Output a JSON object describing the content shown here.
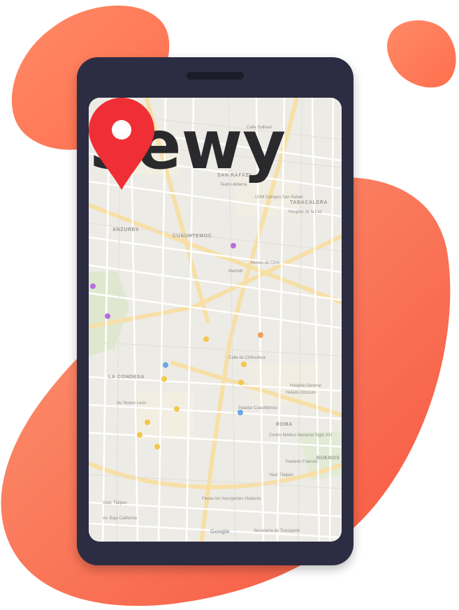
{
  "brand": {
    "logo_text": "Sewy",
    "logo_color": "#2a2a2d"
  },
  "colors": {
    "blob_light": "#fd9974",
    "blob_dark": "#f6553f",
    "phone_body": "#2c2c42",
    "pin": "#ef2f35"
  },
  "pin_icon": "map-pin-icon",
  "map": {
    "area_labels": [
      "SAN RAFAEL",
      "TABACALERA",
      "ANZURES",
      "CUAUHTEMOC",
      "LA CONDESA",
      "ROMA",
      "BUENOS"
    ],
    "street_labels": [
      "Calle Sullivan",
      "Teatro Aldama",
      "UVM Campus San Rafael",
      "Hospital de la Luz",
      "Museo de Cera",
      "Marriott",
      "Calle de Chihuahua",
      "Hospital General",
      "Helado Obscuro",
      "Paladar Cuauhtémoc",
      "Centro Médico Nacional Siglo XXI",
      "Panteón Francés",
      "Viad. Tlalpan",
      "Fiesta Inn Insurgentes Viaducto",
      "Av. Nuevo León",
      "Av. Baja California",
      "Secretaría de Transporte",
      "Viad. Tlalpan"
    ],
    "attribution": "Google"
  }
}
